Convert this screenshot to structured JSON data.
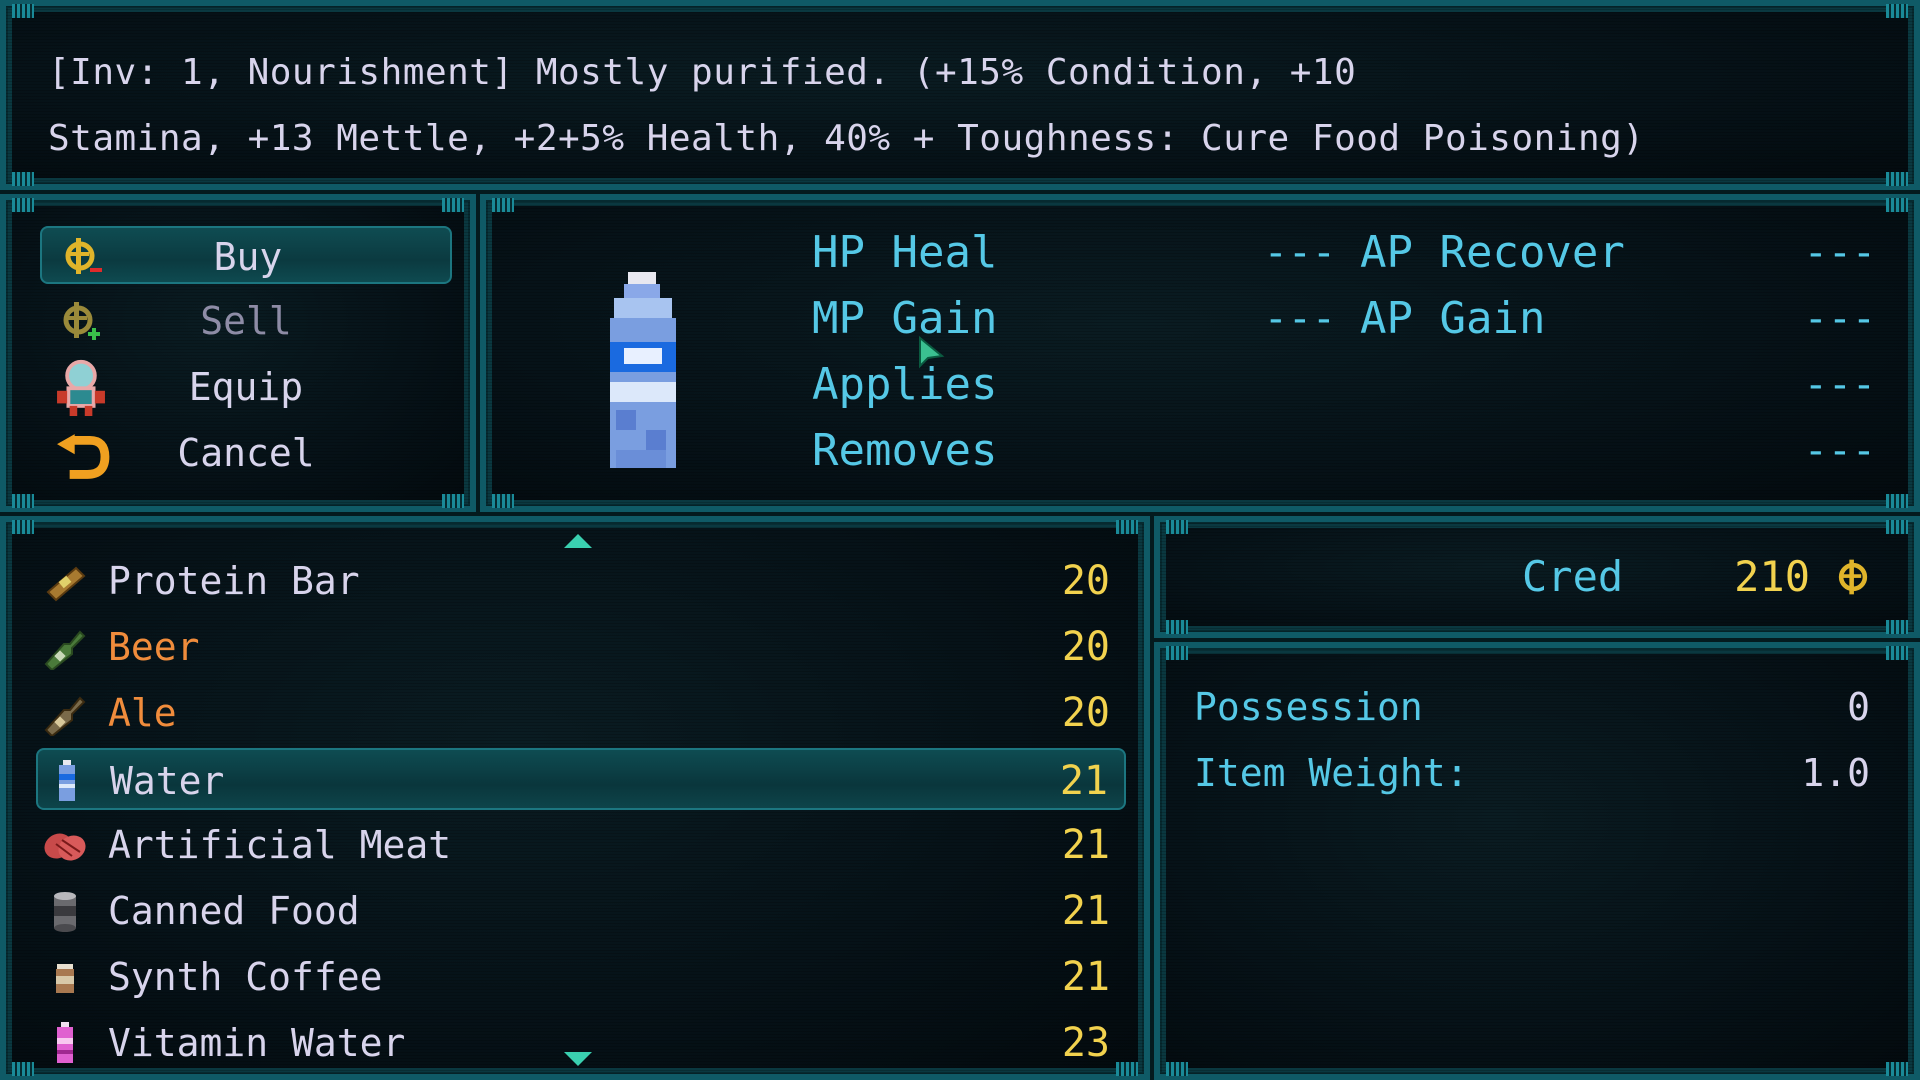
{
  "description": {
    "line1": "[Inv: 1, Nourishment] Mostly purified. (+15% Condition, +10",
    "line2": "Stamina, +13 Mettle, +2+5% Health, 40% + Toughness: Cure Food Poisoning)"
  },
  "commands": [
    {
      "label": "Buy",
      "icon": "cred-minus-icon",
      "selected": true
    },
    {
      "label": "Sell",
      "icon": "cred-plus-icon",
      "selected": false
    },
    {
      "label": "Equip",
      "icon": "character-icon",
      "selected": false
    },
    {
      "label": "Cancel",
      "icon": "back-arrow-icon",
      "selected": false
    }
  ],
  "stats": {
    "hp_heal": {
      "label": "HP Heal",
      "value": "---"
    },
    "mp_gain": {
      "label": "MP Gain",
      "value": "---"
    },
    "applies": {
      "label": "Applies",
      "value": "---"
    },
    "removes": {
      "label": "Removes",
      "value": "---"
    },
    "ap_recover": {
      "label": "AP Recover",
      "value": "---"
    },
    "ap_gain": {
      "label": "AP Gain",
      "value": "---"
    }
  },
  "items": [
    {
      "name": "Protein Bar",
      "price": "20",
      "color": "#d8d4ec",
      "icon": "protein-bar-icon"
    },
    {
      "name": "Beer",
      "price": "20",
      "color": "#f08c3c",
      "icon": "beer-bottle-icon"
    },
    {
      "name": "Ale",
      "price": "20",
      "color": "#f08c3c",
      "icon": "ale-bottle-icon"
    },
    {
      "name": "Water",
      "price": "21",
      "color": "#d8d4ec",
      "icon": "water-bottle-icon",
      "selected": true
    },
    {
      "name": "Artificial Meat",
      "price": "21",
      "color": "#d8d4ec",
      "icon": "meat-icon"
    },
    {
      "name": "Canned Food",
      "price": "21",
      "color": "#d8d4ec",
      "icon": "can-icon"
    },
    {
      "name": "Synth Coffee",
      "price": "21",
      "color": "#d8d4ec",
      "icon": "coffee-cup-icon"
    },
    {
      "name": "Vitamin Water",
      "price": "23",
      "color": "#d8d4ec",
      "icon": "vitamin-water-icon"
    }
  ],
  "currency": {
    "label": "Cred",
    "value": "210",
    "icon": "cred-coin-icon"
  },
  "info": {
    "possession_label": "Possession",
    "possession_value": "0",
    "weight_label": "Item Weight:",
    "weight_value": "1.0"
  },
  "colors": {
    "frame": "#0f5a66",
    "stat_label": "#55c8e6",
    "price": "#f2d24e",
    "alcohol_name": "#f08c3c",
    "text": "#d8d4ec"
  }
}
